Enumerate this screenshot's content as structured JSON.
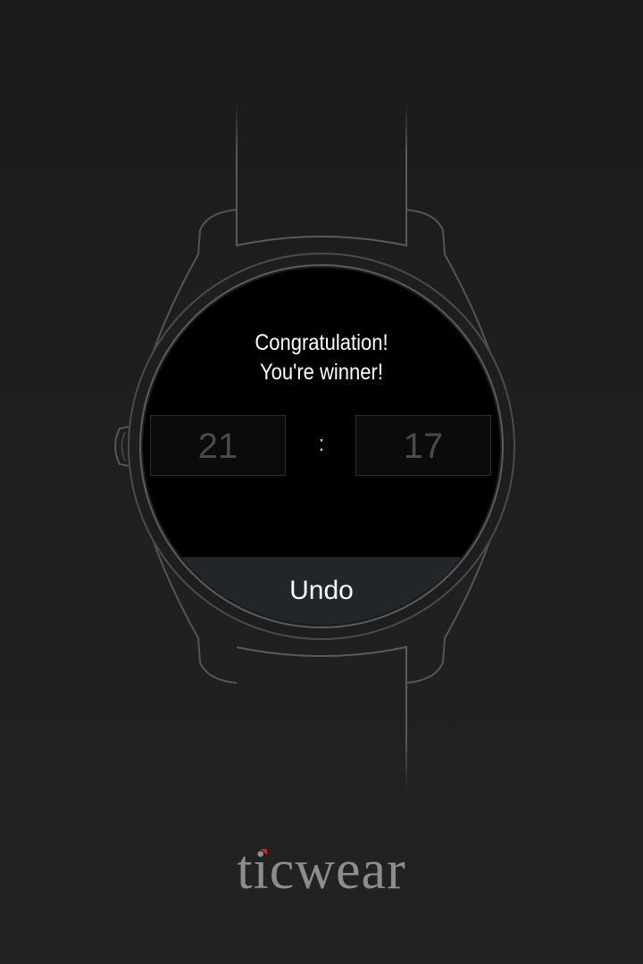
{
  "screen": {
    "message_line1": "Congratulation!",
    "message_line2": "You're winner!",
    "score_left": "21",
    "separator": ":",
    "score_right": "17",
    "undo_label": "Undo"
  },
  "footer": {
    "brand": "ticwear"
  },
  "colors": {
    "accent_red": "#d81f26",
    "undo_bar": "#202629",
    "background": "#1f1f1f"
  }
}
